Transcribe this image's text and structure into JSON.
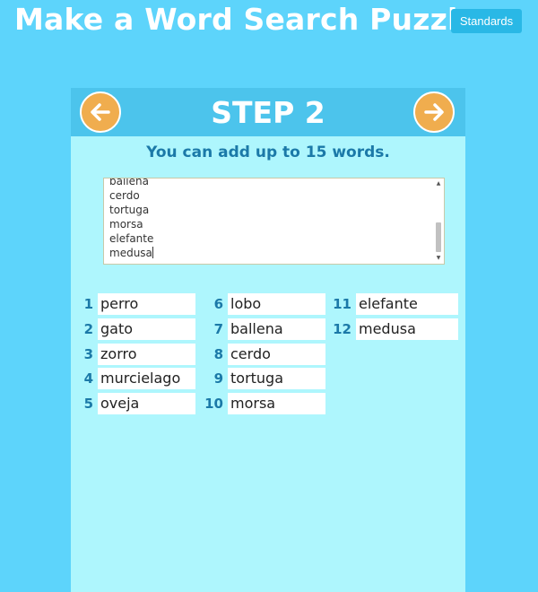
{
  "header": {
    "title": "Make a Word Search Puzzle",
    "standards_label": "Standards"
  },
  "step": {
    "title": "STEP 2",
    "hint": "You can add up to 15 words."
  },
  "textarea": {
    "lines": [
      "ballena",
      "cerdo",
      "tortuga",
      "morsa",
      "elefante",
      "medusa"
    ]
  },
  "words": [
    {
      "num": "1",
      "word": "perro"
    },
    {
      "num": "2",
      "word": "gato"
    },
    {
      "num": "3",
      "word": "zorro"
    },
    {
      "num": "4",
      "word": "murcielago"
    },
    {
      "num": "5",
      "word": "oveja"
    },
    {
      "num": "6",
      "word": "lobo"
    },
    {
      "num": "7",
      "word": "ballena"
    },
    {
      "num": "8",
      "word": "cerdo"
    },
    {
      "num": "9",
      "word": "tortuga"
    },
    {
      "num": "10",
      "word": "morsa"
    },
    {
      "num": "11",
      "word": "elefante"
    },
    {
      "num": "12",
      "word": "medusa"
    }
  ],
  "icons": {
    "prev": "arrow-left-icon",
    "next": "arrow-right-icon"
  },
  "colors": {
    "background": "#5dd4fb",
    "panel": "#aef6fd",
    "header": "#4cc4ec",
    "accent": "#f0ad4e",
    "number": "#1b79a8"
  }
}
